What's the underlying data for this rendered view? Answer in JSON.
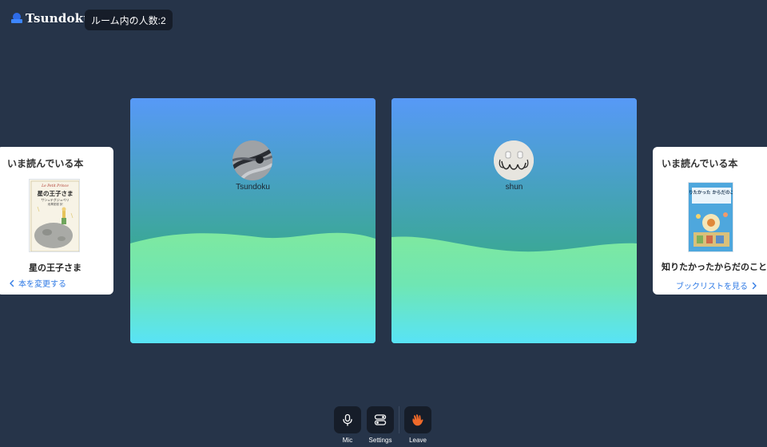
{
  "header": {
    "brand": "Tsundoku",
    "room_count_label": "ルーム内の人数:2"
  },
  "left_card": {
    "title": "いま読んでいる本",
    "book_title": "星の王子さま",
    "link_label": "本を変更する",
    "cover_text": {
      "series": "Le Petit Prince",
      "title": "星の王子さま",
      "author": "サン=テグジュペリ",
      "translator": "池澤夏樹 訳"
    }
  },
  "right_card": {
    "title": "いま読んでいる本",
    "book_title": "知りたかったからだのこと",
    "link_label": "ブックリストを見る",
    "cover_text": {
      "title": "知りたかった からだのこと"
    }
  },
  "participants": [
    {
      "name": "Tsundoku"
    },
    {
      "name": "shun"
    }
  ],
  "controls": {
    "mic": "Mic",
    "settings": "Settings",
    "leave": "Leave"
  },
  "colors": {
    "background": "#263449",
    "badge_bg": "#161d29",
    "link": "#2f7ae5",
    "tile_top": "#5799f7",
    "tile_bottom": "#59e3f7",
    "leave_icon": "#f06a2a"
  },
  "icons": [
    "brand-logo-icon",
    "chevron-left-icon",
    "chevron-right-icon",
    "mic-icon",
    "settings-toggle-icon",
    "wave-hand-icon"
  ]
}
